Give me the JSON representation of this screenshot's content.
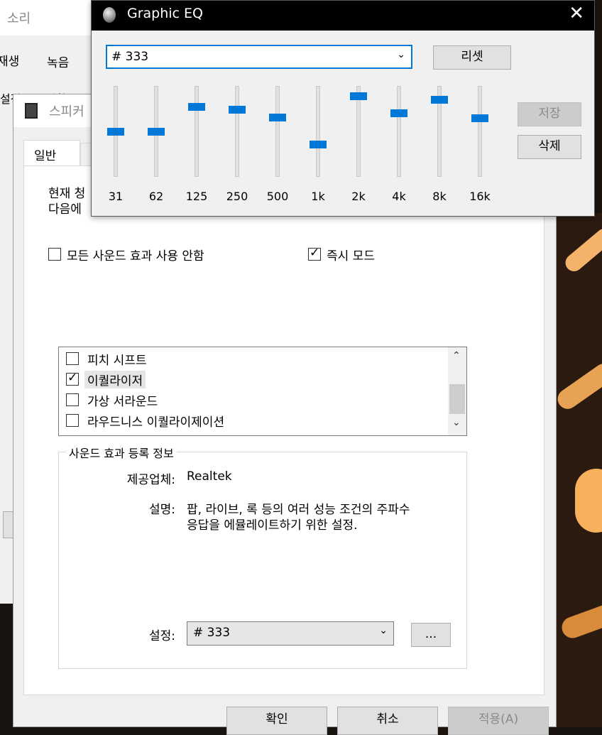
{
  "sound_window": {
    "title": "소리",
    "tabs": [
      "재생",
      "녹음"
    ],
    "partial_text": "설정을 수정할"
  },
  "speaker_window": {
    "title": "스피커",
    "tabs": [
      "일반"
    ],
    "description_lines": [
      "현재 청",
      "다음에"
    ],
    "disable_all_effects": {
      "label": "모든 사운드 효과 사용 안함",
      "checked": false
    },
    "immediate_mode": {
      "label": "즉시 모드",
      "checked": true
    },
    "effects": [
      {
        "label": "피치 시프트",
        "checked": false
      },
      {
        "label": "이퀄라이저",
        "checked": true
      },
      {
        "label": "가상 서라운드",
        "checked": false
      },
      {
        "label": "라우드니스 이퀄라이제이션",
        "checked": false
      }
    ],
    "info_group": {
      "title": "사운드 효과 등록 정보",
      "provider_label": "제공업체:",
      "provider_value": "Realtek",
      "desc_label": "설명:",
      "desc_lines": [
        "팝, 라이브, 록 등의 여러 성능 조건의 주파수",
        "응답을 에뮬레이트하기 위한 설정."
      ],
      "settings_label": "설정:",
      "settings_value": "# 333",
      "more_button": "..."
    },
    "buttons": {
      "ok": "확인",
      "cancel": "취소",
      "apply": "적용(A)"
    }
  },
  "eq_window": {
    "title": "Graphic EQ",
    "close_glyph": "✕",
    "preset_value": "# 333",
    "reset_button": "리셋",
    "save_button": "저장",
    "delete_button": "삭제",
    "bands": [
      {
        "freq": "31",
        "level": 0.5
      },
      {
        "freq": "62",
        "level": 0.5
      },
      {
        "freq": "125",
        "level": 0.77
      },
      {
        "freq": "250",
        "level": 0.74
      },
      {
        "freq": "500",
        "level": 0.66
      },
      {
        "freq": "1k",
        "level": 0.36
      },
      {
        "freq": "2k",
        "level": 0.89
      },
      {
        "freq": "4k",
        "level": 0.7
      },
      {
        "freq": "8k",
        "level": 0.85
      },
      {
        "freq": "16k",
        "level": 0.65
      }
    ]
  },
  "colors": {
    "accent": "#0078d7",
    "window_bg": "#f0f0f0"
  }
}
